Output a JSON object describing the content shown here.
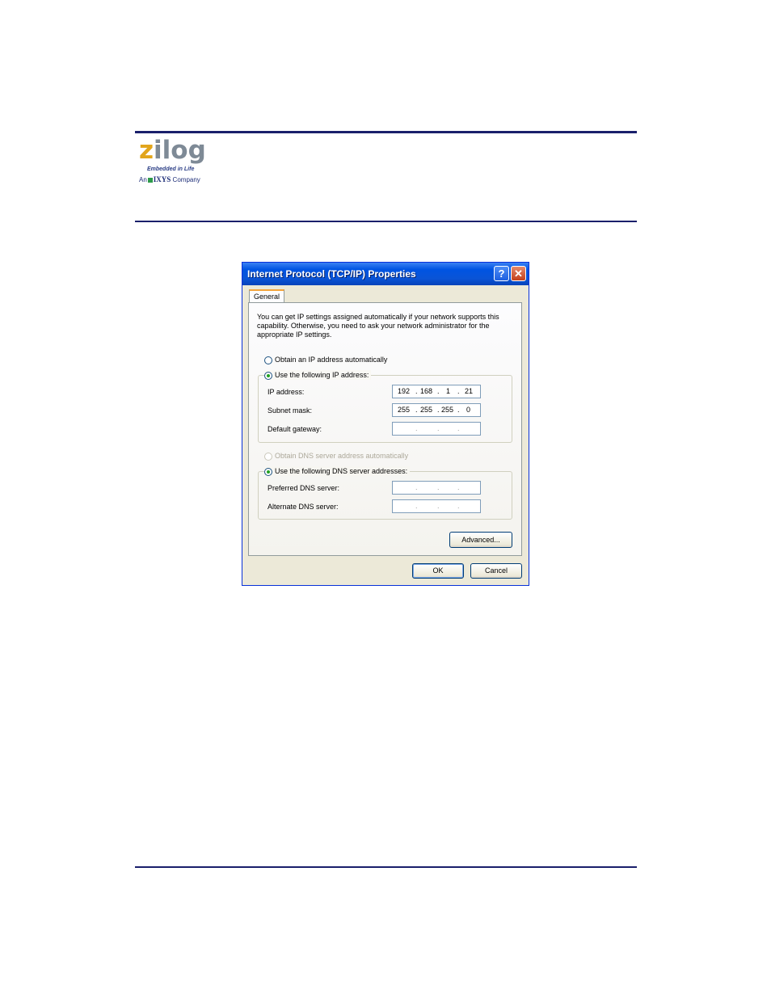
{
  "logo": {
    "wordmark_first": "z",
    "wordmark_rest": "ilog",
    "tagline": "Embedded in Life",
    "company_prefix": "An",
    "company_name": "IXYS",
    "company_suffix": "Company"
  },
  "dialog": {
    "title": "Internet Protocol (TCP/IP) Properties",
    "help_icon_glyph": "?",
    "close_icon_glyph": "✕",
    "tab_label": "General",
    "intro_text": "You can get IP settings assigned automatically if your network supports this capability. Otherwise, you need to ask your network administrator for the appropriate IP settings.",
    "ip_section": {
      "auto_label": "Obtain an IP address automatically",
      "manual_label": "Use the following IP address:",
      "selected": "manual",
      "ip_address_label": "IP address:",
      "ip_address": [
        "192",
        "168",
        "1",
        "21"
      ],
      "subnet_label": "Subnet mask:",
      "subnet_mask": [
        "255",
        "255",
        "255",
        "0"
      ],
      "gateway_label": "Default gateway:",
      "gateway": [
        "",
        "",
        "",
        ""
      ]
    },
    "dns_section": {
      "auto_label": "Obtain DNS server address automatically",
      "manual_label": "Use the following DNS server addresses:",
      "selected": "manual",
      "preferred_label": "Preferred DNS server:",
      "preferred": [
        "",
        "",
        "",
        ""
      ],
      "alternate_label": "Alternate DNS server:",
      "alternate": [
        "",
        "",
        "",
        ""
      ]
    },
    "buttons": {
      "advanced": "Advanced...",
      "ok": "OK",
      "cancel": "Cancel"
    },
    "colors": {
      "titlebar": "#0054e3",
      "radio_dot": "#21a121",
      "tab_accent": "#f3a33a"
    }
  }
}
